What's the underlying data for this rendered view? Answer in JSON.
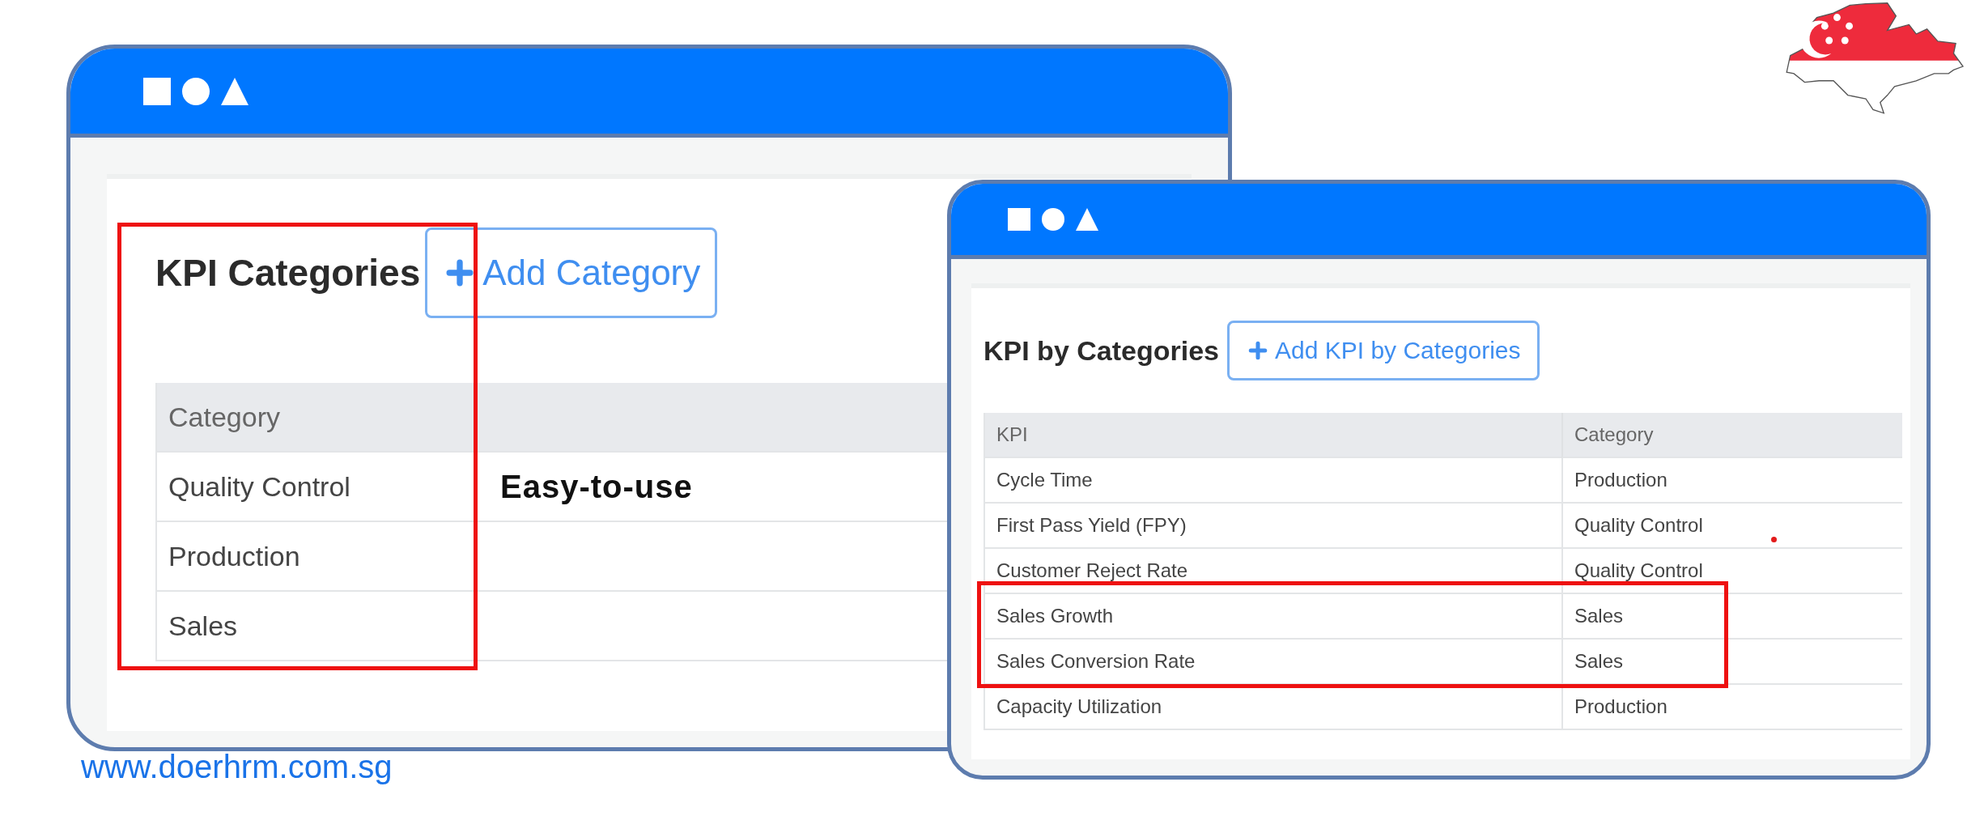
{
  "windows": [
    {
      "heading": "KPI Categories",
      "add_button": "Add Category",
      "columns": [
        "Category"
      ],
      "rows": [
        [
          "Quality Control"
        ],
        [
          "Production"
        ],
        [
          "Sales"
        ]
      ],
      "caption": "Easy-to-use"
    },
    {
      "heading": "KPI by Categories",
      "add_button": "Add KPI by Categories",
      "columns": [
        "KPI",
        "Category"
      ],
      "rows": [
        [
          "Cycle Time",
          "Production"
        ],
        [
          "First Pass Yield (FPY)",
          "Quality Control"
        ],
        [
          "Customer Reject Rate",
          "Quality Control"
        ],
        [
          "Sales Growth",
          "Sales"
        ],
        [
          "Sales Conversion Rate",
          "Sales"
        ],
        [
          "Capacity Utilization",
          "Production"
        ]
      ]
    }
  ],
  "website": "www.doerhrm.com.sg"
}
